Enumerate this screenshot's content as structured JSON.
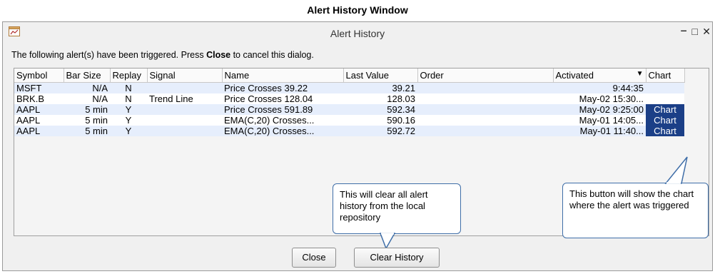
{
  "caption": "Alert History Window",
  "window": {
    "title": "Alert History",
    "controls": {
      "minimize": "‒",
      "maximize": "□",
      "close": "✕"
    }
  },
  "message": {
    "before": "The following alert(s) have been triggered. Press ",
    "bold": "Close",
    "after": " to cancel this dialog."
  },
  "table": {
    "columns": [
      "Symbol",
      "Bar Size",
      "Replay",
      "Signal",
      "Name",
      "Last Value",
      "Order",
      "Activated",
      "Chart"
    ],
    "sort_indicator": "▼",
    "rows": [
      {
        "symbol": "MSFT",
        "bar_size": "N/A",
        "replay": "N",
        "signal": "",
        "name": "Price Crosses 39.22",
        "last_value": "39.21",
        "order": "",
        "activated": "9:44:35",
        "chart": ""
      },
      {
        "symbol": "BRK.B",
        "bar_size": "N/A",
        "replay": "N",
        "signal": "Trend Line",
        "name": "Price Crosses 128.04",
        "last_value": "128.03",
        "order": "",
        "activated": "May-02 15:30...",
        "chart": ""
      },
      {
        "symbol": "AAPL",
        "bar_size": "5 min",
        "replay": "Y",
        "signal": "",
        "name": "Price Crosses 591.89",
        "last_value": "592.34",
        "order": "",
        "activated": "May-02 9:25:00",
        "chart": "Chart"
      },
      {
        "symbol": "AAPL",
        "bar_size": "5 min",
        "replay": "Y",
        "signal": "",
        "name": "EMA(C,20) Crosses...",
        "last_value": "590.16",
        "order": "",
        "activated": "May-01 14:05...",
        "chart": "Chart"
      },
      {
        "symbol": "AAPL",
        "bar_size": "5 min",
        "replay": "Y",
        "signal": "",
        "name": "EMA(C,20) Crosses...",
        "last_value": "592.72",
        "order": "",
        "activated": "May-01 11:40...",
        "chart": "Chart"
      }
    ]
  },
  "callouts": {
    "clear_history": "This will clear all alert history from the local repository",
    "chart_button": "This button will show the chart where the alert was triggered"
  },
  "buttons": {
    "close": "Close",
    "clear_history": "Clear History"
  },
  "colors": {
    "chart_button_bg": "#1b3f87",
    "callout_border": "#3f6ea8",
    "row_highlight": "#e6eefc"
  }
}
